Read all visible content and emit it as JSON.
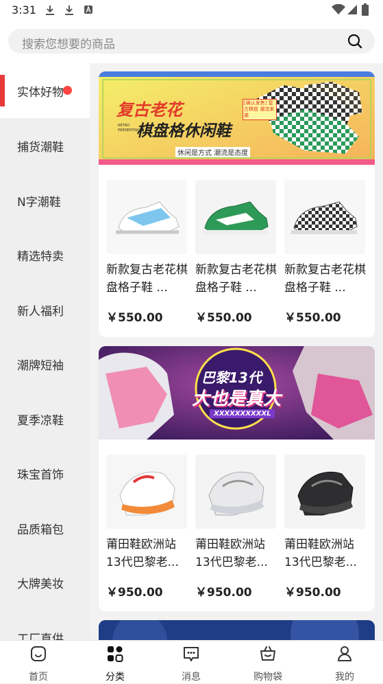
{
  "status_bar": {
    "time": "3:31"
  },
  "search": {
    "placeholder": "搜索您想要的商品"
  },
  "sidebar": {
    "items": [
      {
        "label": "实体好物",
        "active": true,
        "badge": true
      },
      {
        "label": "捕货潮鞋"
      },
      {
        "label": "N字潮鞋"
      },
      {
        "label": "精选特卖"
      },
      {
        "label": "新人福利"
      },
      {
        "label": "潮牌短袖"
      },
      {
        "label": "夏季凉鞋"
      },
      {
        "label": "珠宝首饰"
      },
      {
        "label": "品质箱包"
      },
      {
        "label": "大牌美妆"
      },
      {
        "label": "工厂直供"
      }
    ]
  },
  "sections": [
    {
      "banner": {
        "title1": "复古老花",
        "title2": "棋盘格休闲鞋",
        "tag": "休闲是方式 潮流是态度",
        "brand": "RETRO PRESENTING",
        "stamp": "[确认发售] 复古棋盘 潮流来袭"
      },
      "products": [
        {
          "title": "新款复古老花棋盘格子鞋 ...",
          "price": "￥550.00"
        },
        {
          "title": "新款复古老花棋盘格子鞋 ...",
          "price": "￥550.00"
        },
        {
          "title": "新款复古老花棋盘格子鞋 ...",
          "price": "￥550.00"
        }
      ]
    },
    {
      "banner": {
        "title1": "巴黎13代",
        "title2": "大也是真大",
        "tag": "XXXXXXXXXXL"
      },
      "products": [
        {
          "title": "莆田鞋欧洲站13代巴黎老...",
          "price": "￥950.00"
        },
        {
          "title": "莆田鞋欧洲站13代巴黎老...",
          "price": "￥950.00"
        },
        {
          "title": "莆田鞋欧洲站13代巴黎老...",
          "price": "￥950.00"
        }
      ]
    }
  ],
  "bottom_nav": [
    {
      "label": "首页",
      "icon": "home-icon"
    },
    {
      "label": "分类",
      "icon": "category-icon",
      "active": true
    },
    {
      "label": "消息",
      "icon": "message-icon"
    },
    {
      "label": "购物袋",
      "icon": "basket-icon"
    },
    {
      "label": "我的",
      "icon": "user-icon"
    }
  ],
  "colors": {
    "accent": "#e83a3a",
    "banner1_bg": "#f7e94a",
    "banner2_bg": "#5a2a7a"
  }
}
